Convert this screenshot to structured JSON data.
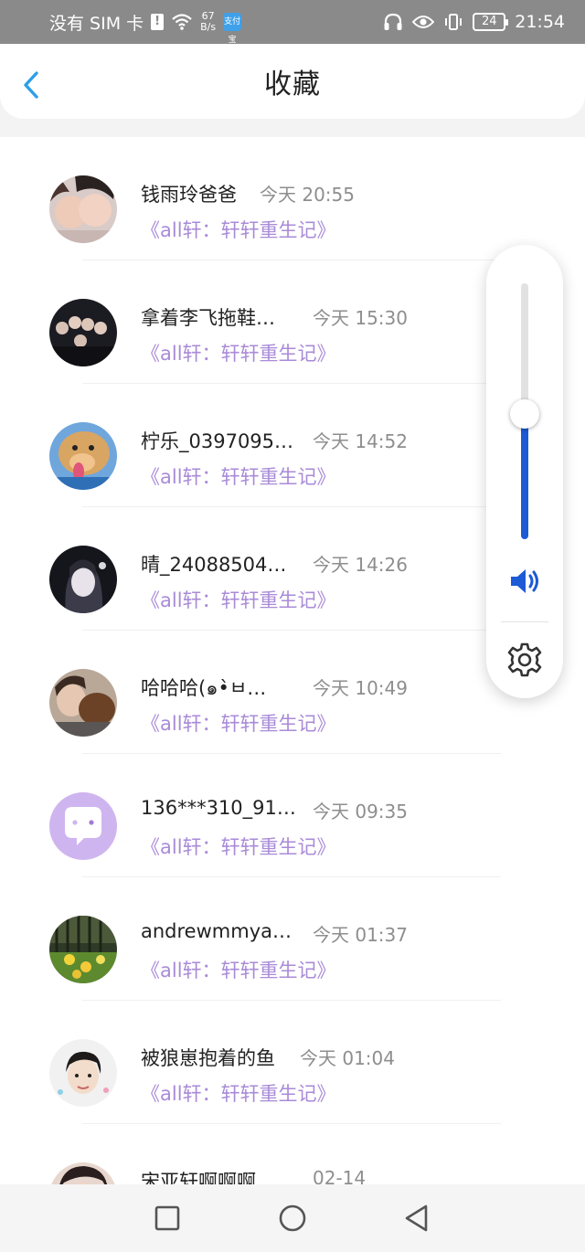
{
  "status_bar": {
    "carrier": "没有 SIM 卡",
    "sim_alert": "!",
    "net_speed_value": "67",
    "net_speed_unit": "B/s",
    "app_badge": "支付宝",
    "battery": "24",
    "time": "21:54",
    "icons": [
      "sim-alert-icon",
      "wifi-icon",
      "app-badge-icon",
      "headphones-icon",
      "eye-icon",
      "vibrate-icon",
      "battery-icon"
    ]
  },
  "header": {
    "title": "收藏",
    "back_icon": "chevron-left-icon",
    "accent_color": "#2d9ee8"
  },
  "list": {
    "items": [
      {
        "name": "钱雨玲爸爸",
        "time": "今天 20:55",
        "work": "《all轩：轩轩重生记》",
        "avatar": "photo-two-girls"
      },
      {
        "name": "拿着李飞拖鞋…",
        "time": "今天 15:30",
        "work": "《all轩：轩轩重生记》",
        "avatar": "photo-group"
      },
      {
        "name": "柠乐_0397095…",
        "time": "今天 14:52",
        "work": "《all轩：轩轩重生记》",
        "avatar": "photo-dog"
      },
      {
        "name": "晴_24088504…",
        "time": "今天 14:26",
        "work": "《all轩：轩轩重生记》",
        "avatar": "anime-girl"
      },
      {
        "name": "哈哈哈(๑•̀ㅂ…",
        "time": "今天 10:49",
        "work": "《all轩：轩轩重生记》",
        "avatar": "photo-person-with-dog"
      },
      {
        "name": "136***310_91…",
        "time": "今天 09:35",
        "work": "《all轩：轩轩重生记》",
        "avatar": "default-chat-bubble"
      },
      {
        "name": "andrewmmya…",
        "time": "今天 01:37",
        "work": "《all轩：轩轩重生记》",
        "avatar": "photo-flowers"
      },
      {
        "name": "被狼崽抱着的鱼",
        "time": "今天 01:04",
        "work": "《all轩：轩轩重生记》",
        "avatar": "photo-boy"
      },
      {
        "name": "宋亚轩啊啊啊…",
        "time": "02-14",
        "work": "",
        "avatar": "photo-partial"
      }
    ],
    "quote_color": "#a98bd8"
  },
  "volume_panel": {
    "level": 0.49,
    "fill_color": "#1c5ad6",
    "speaker_icon": "speaker-icon",
    "settings_icon": "gear-icon"
  },
  "nav_bar": {
    "buttons": [
      "recent-apps-square-icon",
      "home-circle-icon",
      "back-triangle-icon"
    ]
  }
}
